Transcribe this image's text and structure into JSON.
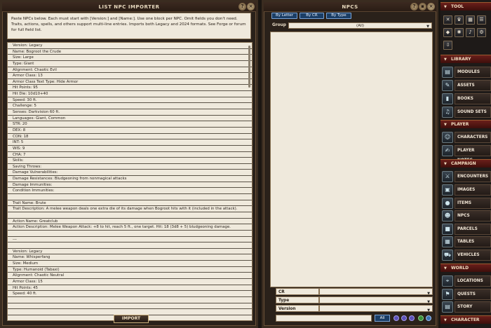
{
  "left_window": {
    "title": "LIST NPC IMPORTER",
    "instructions": "Paste NPCs below. Each must start with [Version:] and [Name:]. Use one block per NPC. Omit fields you don't need. Traits, actions, spells, and others support multi-line entries. Imports both Legacy and 2024 formats. See Forge or forum for full field list.",
    "lines": [
      "Version: Legacy",
      "Name: Bogroot the Crude",
      "Size: Large",
      "Type: Giant",
      "Alignment: Chaotic Evil",
      "Armor Class: 13",
      "Armor Class Text Type: Hide Armor",
      "Hit Points: 95",
      "Hit Die: 10d10+40",
      "Speed: 30 ft.",
      "Challenge: 5",
      "Senses: Darkvision 60 ft.",
      "Languages: Giant, Common",
      "STR: 20",
      "DEX: 8",
      "CON: 18",
      "INT: 5",
      "WIS: 9",
      "CHA: 7",
      "Skills:",
      "Saving Throws:",
      "Damage Vulnerabilities:",
      "Damage Resistances: Bludgeoning from nonmagical attacks",
      "Damage Immunities:",
      "Condition Immunities:",
      "",
      "Trait Name: Brute",
      "Trait Description: A melee weapon deals one extra die of its damage when Bogroot hits with it (included in the attack).",
      "",
      "Action Name: Greatclub",
      "Action Description: Melee Weapon Attack: +8 to hit, reach 5 ft., one target. Hit: 18 (3d8 + 5) bludgeoning damage.",
      "",
      "---",
      "",
      "Version: Legacy",
      "Name: Whisperfang",
      "Size: Medium",
      "Type: Humanoid (Tabaxi)",
      "Alignment: Chaotic Neutral",
      "Armor Class: 15",
      "Hit Points: 45",
      "Speed: 40 ft.",
      "",
      "",
      ""
    ],
    "import_label": "IMPORT"
  },
  "mid_window": {
    "title": "NPCS",
    "tabs": [
      "By Letter",
      "By CR",
      "By Type"
    ],
    "group_label": "Group",
    "group_value": "(All)",
    "filters": [
      "CR",
      "Type",
      "Version"
    ],
    "all_label": "All"
  },
  "sidebar": {
    "sections": {
      "tool": "TOOL",
      "library": "LIBRARY",
      "player": "PLAYER",
      "campaign": "CAMPAIGN",
      "world": "WORLD",
      "character": "CHARACTER"
    },
    "library_items": [
      "MODULES",
      "ASSETS",
      "BOOKS",
      "SOUND SETS"
    ],
    "player_items": [
      "CHARACTERS",
      "PLAYER NOTES"
    ],
    "campaign_items": [
      "ENCOUNTERS",
      "IMAGES",
      "ITEMS",
      "NPCS",
      "PARCELS",
      "TABLES",
      "VEHICLES"
    ],
    "world_items": [
      "LOCATIONS",
      "QUESTS",
      "STORY"
    ]
  },
  "colors": {
    "accent": "#1b3e66",
    "section": "#6a1f1a",
    "paper": "#efe9dc"
  }
}
